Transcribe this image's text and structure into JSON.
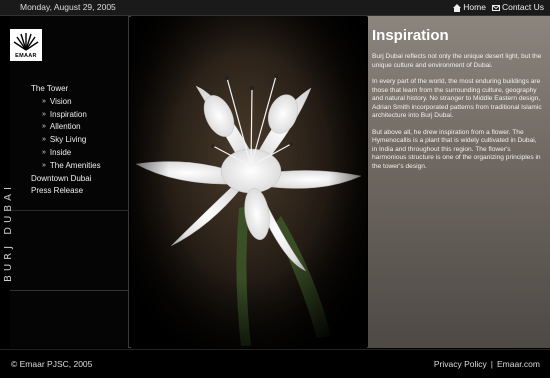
{
  "topbar": {
    "date": "Monday, August 29, 2005",
    "links": [
      {
        "label": "Home",
        "icon": "home-icon"
      },
      {
        "label": "Contact Us",
        "icon": "mail-icon"
      }
    ]
  },
  "logo": {
    "text": "EMAAR"
  },
  "nav": {
    "tower": "The Tower",
    "sub_items": [
      "Vision",
      "Inspiration",
      "Allention",
      "Sky Living",
      "Inside",
      "The Amenities"
    ],
    "downtown": "Downtown Dubai",
    "press": "Press Release"
  },
  "sidebar_title": "BURJ DUBAI",
  "panel": {
    "title": "Inspiration",
    "paragraphs": [
      "Burj Dubai reflects not only the unique desert light, but the unique culture and environment of Dubai.",
      "In every part of the world, the most enduring buildings are those that learn from the surrounding culture, geography and natural history. No stranger to Middle Eastern design, Adrian Smith incorporated patterns from traditional Islamic architecture into Burj Dubai.",
      "But above all, he drew inspiration from a flower. The Hymenocallis is a plant that is widely cultivated in Dubai, in India and throughout this region. The flower's harmonious structure is one of the organizing principles in the tower's design."
    ]
  },
  "footer": {
    "copyright": "© Emaar PJSC, 2005",
    "privacy": "Privacy Policy",
    "separator": "|",
    "site": "Emaar.com"
  }
}
